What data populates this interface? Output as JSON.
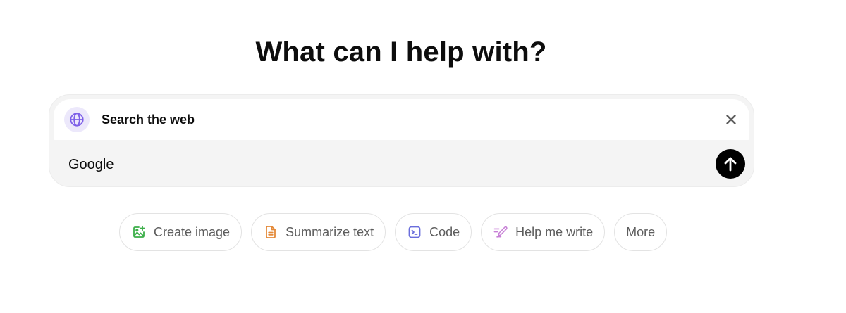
{
  "heading": "What can I help with?",
  "composer": {
    "tool": {
      "label": "Search the web",
      "icon": "globe-icon",
      "icon_color": "#7d5fe8",
      "icon_bg": "#ece8fb"
    },
    "close_icon": "close-icon",
    "input_value": "Google",
    "send_icon": "arrow-up-icon"
  },
  "chips": [
    {
      "label": "Create image",
      "icon": "image-plus-icon",
      "color": "#3bae48"
    },
    {
      "label": "Summarize text",
      "icon": "document-icon",
      "color": "#e48a3a"
    },
    {
      "label": "Code",
      "icon": "terminal-icon",
      "color": "#6a6edc"
    },
    {
      "label": "Help me write",
      "icon": "pen-icon",
      "color": "#c77fd6"
    },
    {
      "label": "More",
      "icon": "",
      "color": ""
    }
  ]
}
